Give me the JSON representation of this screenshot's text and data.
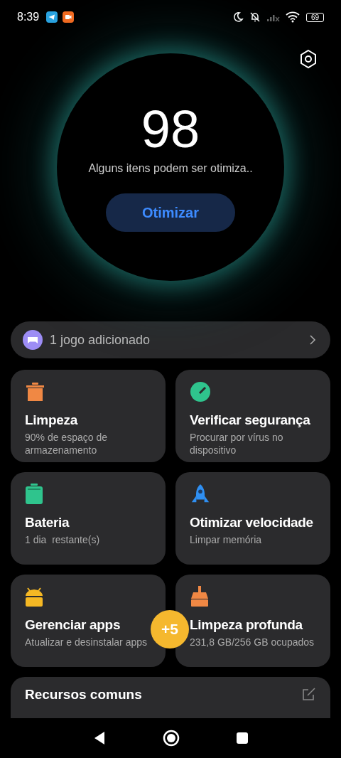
{
  "status_bar": {
    "time": "8:39",
    "battery": "69"
  },
  "score": {
    "value": "98",
    "message": "Alguns itens podem ser otimiza..",
    "button": "Otimizar"
  },
  "game_row": {
    "label": "1 jogo adicionado"
  },
  "tiles": [
    {
      "kind": "trash",
      "title": "Limpeza",
      "subtitle": "90% de espaço de armazenamento"
    },
    {
      "kind": "shield",
      "title": "Verificar segurança",
      "subtitle": "Procurar por vírus no dispositivo"
    },
    {
      "kind": "battery",
      "title": "Bateria",
      "subtitle": "1 dia  restante(s)"
    },
    {
      "kind": "rocket",
      "title": "Otimizar velocidade",
      "subtitle": "Limpar memória"
    },
    {
      "kind": "android",
      "title": "Gerenciar apps",
      "subtitle": "Atualizar e desinstalar apps"
    },
    {
      "kind": "brush",
      "title": "Limpeza profunda",
      "subtitle": "231,8 GB/256 GB ocupados"
    }
  ],
  "more_badge": "+5",
  "section": {
    "title": "Recursos comuns"
  }
}
